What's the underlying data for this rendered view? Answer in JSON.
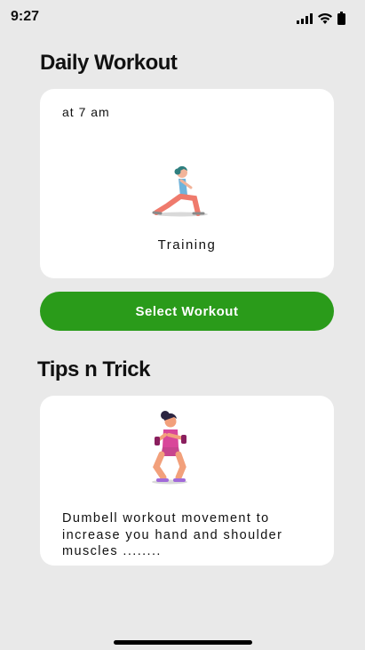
{
  "status_bar": {
    "time": "9:27",
    "icons": [
      "signal-icon",
      "wifi-icon",
      "battery-icon"
    ]
  },
  "daily_workout": {
    "heading": "Daily Workout",
    "card": {
      "time_label": "at 7 am",
      "illustration": "training-illustration",
      "caption": "Training"
    },
    "button_label": "Select Workout"
  },
  "tips": {
    "heading": "Tips n Trick",
    "card": {
      "illustration": "dumbbell-workout-illustration",
      "text": "Dumbell workout movement to increase you hand and shoulder muscles ........"
    }
  },
  "colors": {
    "accent": "#2a9b1a",
    "background": "#e9e9e9",
    "card": "#ffffff"
  }
}
